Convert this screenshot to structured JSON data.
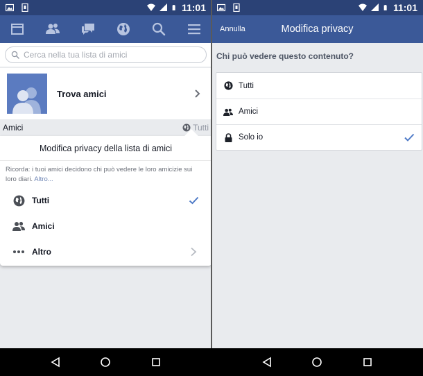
{
  "status": {
    "time_left": "11:01",
    "time_right": "11:01"
  },
  "left": {
    "search": {
      "placeholder": "Cerca nella tua lista di amici"
    },
    "find_friends": {
      "label": "Trova amici"
    },
    "friends_header": {
      "label": "Amici",
      "privacy": "Tutti"
    },
    "popup": {
      "title": "Modifica privacy della lista di amici",
      "note": "Ricorda: i tuoi amici decidono chi può vedere le loro amicizie sui loro diari.",
      "note_more": "Altro...",
      "options": [
        {
          "label": "Tutti",
          "icon": "globe-icon",
          "selected": true
        },
        {
          "label": "Amici",
          "icon": "friends-icon",
          "selected": false
        },
        {
          "label": "Altro",
          "icon": "more-icon",
          "selected": false
        }
      ]
    }
  },
  "right": {
    "header": {
      "cancel": "Annulla",
      "title": "Modifica privacy"
    },
    "question": "Chi può vedere questo contenuto?",
    "options": [
      {
        "label": "Tutti",
        "icon": "globe-icon",
        "selected": false
      },
      {
        "label": "Amici",
        "icon": "friends-icon",
        "selected": false
      },
      {
        "label": "Solo io",
        "icon": "lock-icon",
        "selected": true
      }
    ]
  },
  "colors": {
    "brand": "#3b5998",
    "status_bar": "#2b4276",
    "check": "#4e7ac7",
    "background": "#e9ebee"
  }
}
